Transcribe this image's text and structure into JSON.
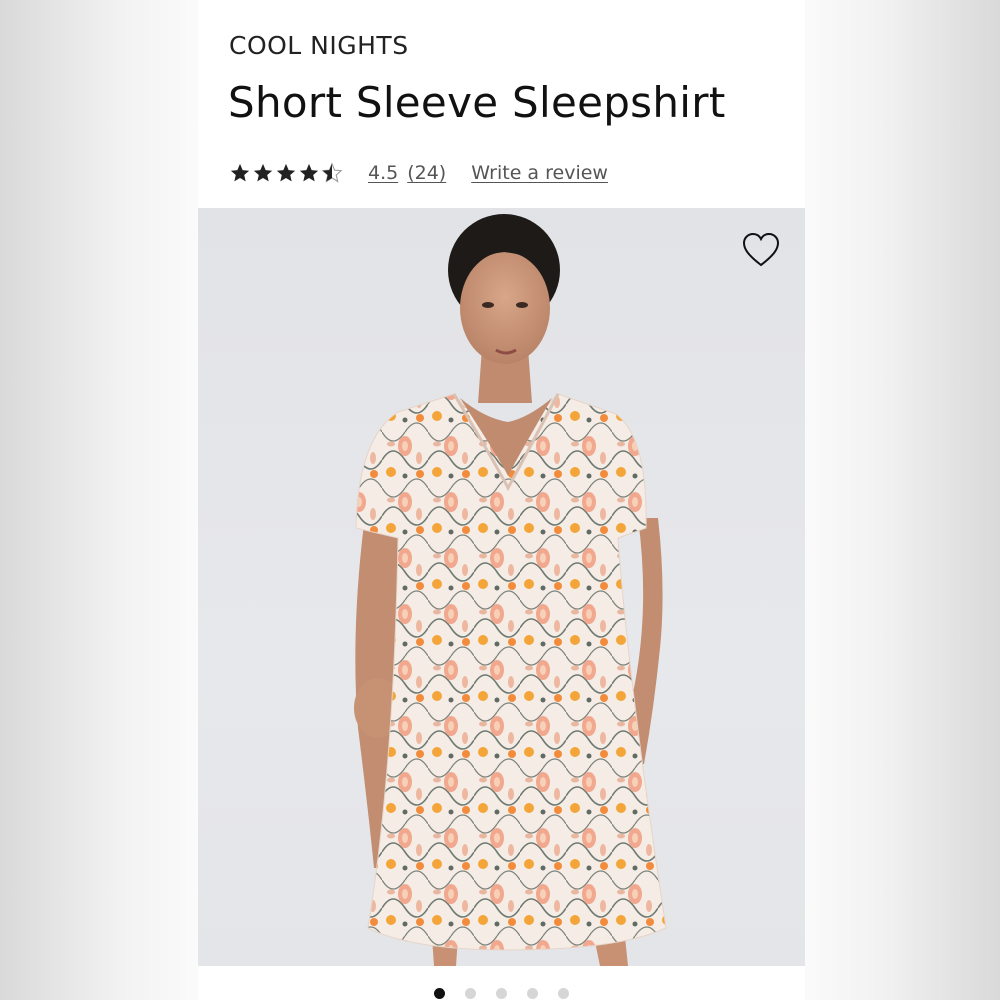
{
  "product": {
    "brand": "COOL NIGHTS",
    "title": "Short Sleeve Sleepshirt",
    "rating_value": "4.5",
    "rating_count": "(24)",
    "rating_stars": 4.5,
    "write_review_label": "Write a review"
  },
  "gallery": {
    "favorite_icon": "heart-outline-icon",
    "image_count": 5,
    "active_index": 0
  },
  "colors": {
    "text_primary": "#111111",
    "star_color": "#222222",
    "dot_active": "#111111",
    "dot_inactive": "#d6d6d6"
  }
}
